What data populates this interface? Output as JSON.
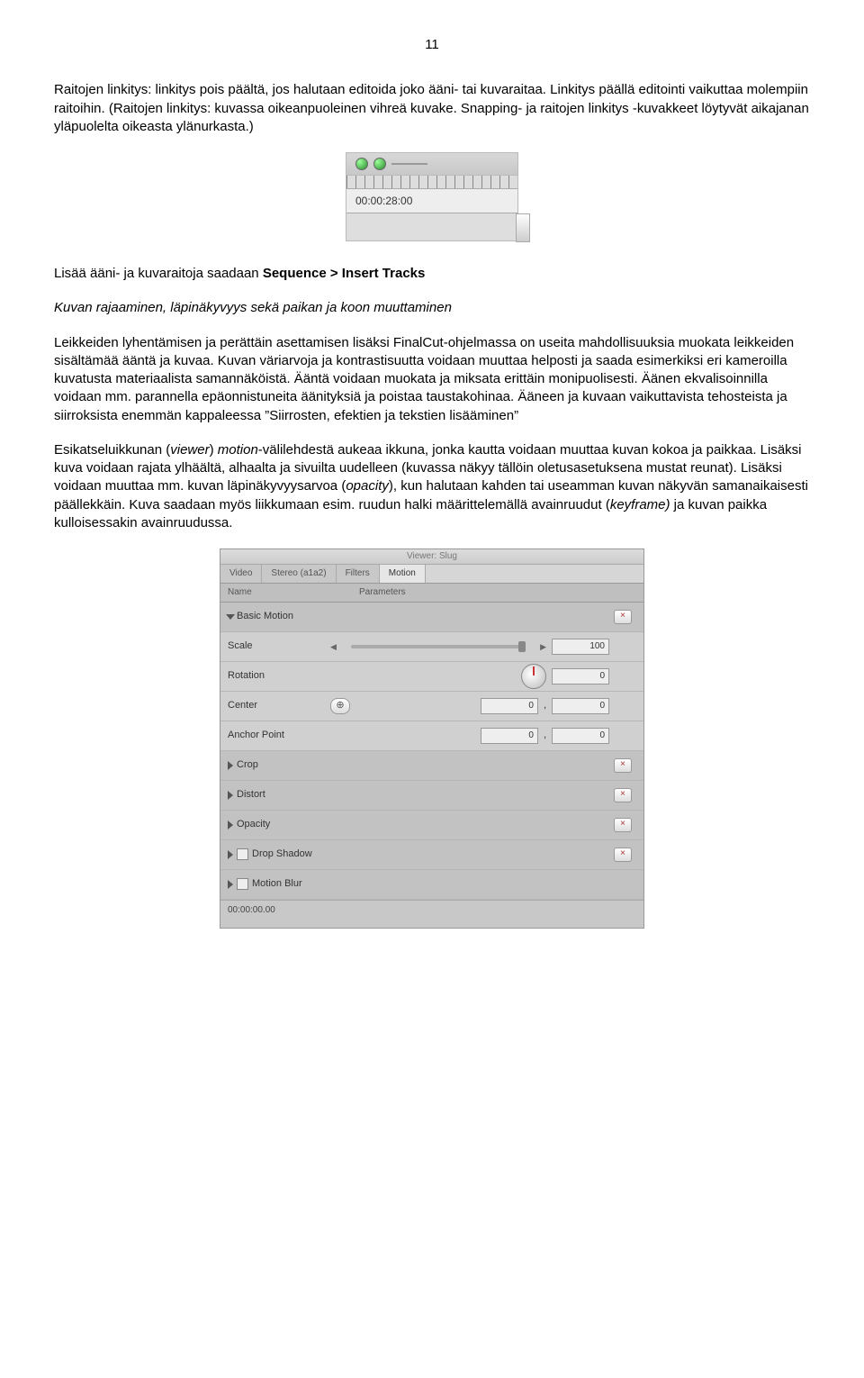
{
  "page_number": "11",
  "para1": {
    "t1": "Raitojen linkitys: linkitys pois päältä, jos halutaan editoida joko ääni- tai kuvaraitaa. Linkitys päällä editointi vaikuttaa molempiin raitoihin. (Raitojen linkitys: kuvassa oikeanpuoleinen vihreä kuvake. Snapping- ja raitojen linkitys -kuvakkeet löytyvät aikajanan yläpuolelta oikeasta ylänurkasta.)"
  },
  "timecode": "00:00:28:00",
  "insert_tracks": {
    "before": "Lisää ääni- ja kuvaraitoja saadaan ",
    "bold": "Sequence > Insert Tracks"
  },
  "heading2": "Kuvan rajaaminen, läpinäkyvyys sekä paikan ja koon muuttaminen",
  "para3": "Leikkeiden lyhentämisen ja perättäin asettamisen lisäksi FinalCut-ohjelmassa on useita mahdollisuuksia muokata leikkeiden sisältämää ääntä ja kuvaa. Kuvan väriarvoja ja kontrastisuutta voidaan muuttaa helposti ja saada esimerkiksi eri kameroilla kuvatusta materiaalista samannäköistä. Ääntä voidaan muokata ja miksata erittäin monipuolisesti. Äänen ekvalisoinnilla voidaan mm. parannella epäonnistuneita äänityksiä ja poistaa taustakohinaa. Ääneen ja kuvaan vaikuttavista tehosteista ja siirroksista enemmän kappaleessa ”Siirrosten, efektien ja tekstien lisääminen”",
  "para4": {
    "t1": "Esikatseluikkunan (",
    "i1": "viewer",
    "t2": ") ",
    "i2": "motion",
    "t3": "-välilehdestä aukeaa ikkuna, jonka kautta voidaan muuttaa kuvan kokoa ja paikkaa. Lisäksi kuva voidaan rajata ylhäältä, alhaalta ja sivuilta uudelleen (kuvassa näkyy tällöin oletusasetuksena mustat reunat). Lisäksi voidaan muuttaa mm. kuvan läpinäkyvyysarvoa (",
    "i3": "opacity",
    "t4": "), kun halutaan kahden tai useamman kuvan näkyvän samanaikaisesti päällekkäin. Kuva saadaan myös liikkumaan esim. ruudun halki määrittelemällä avainruudut (",
    "i4": "keyframe)",
    "t5": " ja kuvan paikka kulloisessakin avainruudussa."
  },
  "motion": {
    "title": "Viewer: Slug",
    "tabs": [
      "Video",
      "Stereo (a1a2)",
      "Filters",
      "Motion"
    ],
    "hdr_name": "Name",
    "hdr_params": "Parameters",
    "basic": "Basic Motion",
    "scale": "Scale",
    "scale_val": "100",
    "rotation": "Rotation",
    "rotation_val": "0",
    "center": "Center",
    "center_x": "0",
    "center_y": "0",
    "anchor": "Anchor Point",
    "anchor_x": "0",
    "anchor_y": "0",
    "crop": "Crop",
    "distort": "Distort",
    "opacity": "Opacity",
    "dropshadow": "Drop Shadow",
    "motionblur": "Motion Blur",
    "footer_tc": "00:00:00.00"
  }
}
